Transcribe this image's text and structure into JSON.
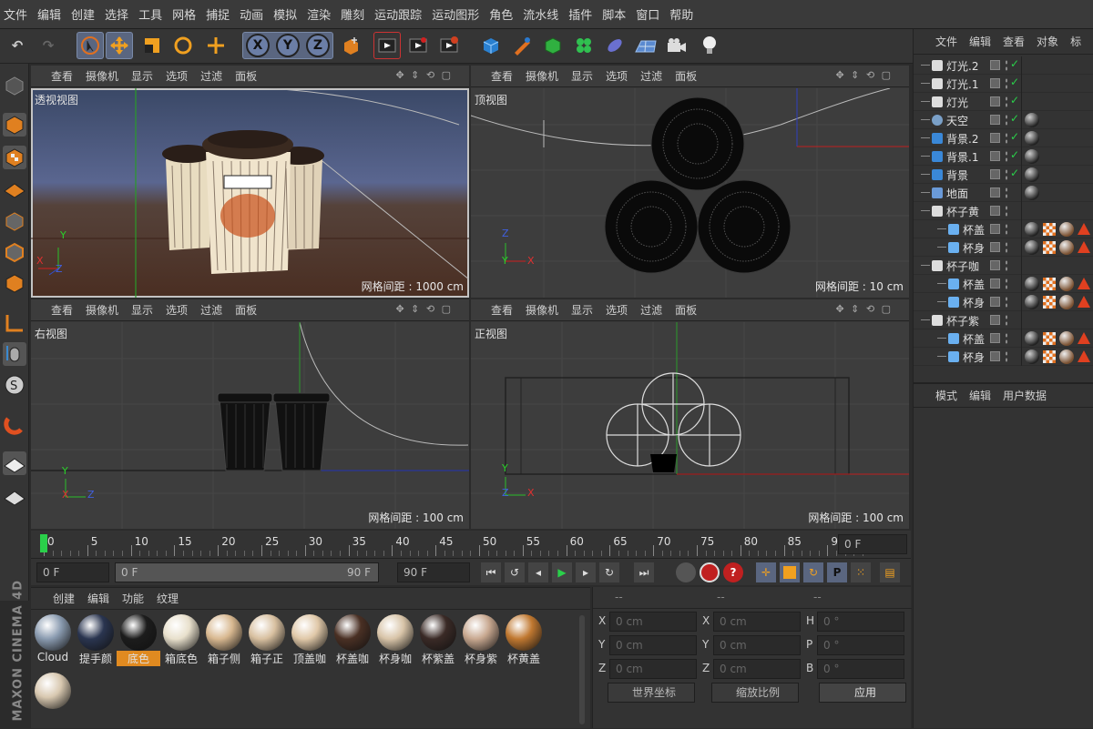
{
  "menu": [
    "文件",
    "编辑",
    "创建",
    "选择",
    "工具",
    "网格",
    "捕捉",
    "动画",
    "模拟",
    "渲染",
    "雕刻",
    "运动跟踪",
    "运动图形",
    "角色",
    "流水线",
    "插件",
    "脚本",
    "窗口",
    "帮助"
  ],
  "toolbar": {
    "axis_x": "X",
    "axis_y": "Y",
    "axis_z": "Z"
  },
  "viewport_menu": [
    "查看",
    "摄像机",
    "显示",
    "选项",
    "过滤",
    "面板"
  ],
  "viewports": [
    {
      "name": "透视视图",
      "grid": "网格间距 : 1000 cm"
    },
    {
      "name": "顶视图",
      "grid": "网格间距 : 10 cm"
    },
    {
      "name": "右视图",
      "grid": "网格间距 : 100 cm"
    },
    {
      "name": "正视图",
      "grid": "网格间距 : 100 cm"
    }
  ],
  "axis_labels": {
    "x": "X",
    "y": "Y",
    "z": "Z"
  },
  "timeline": {
    "ticks": [
      "0",
      "5",
      "10",
      "15",
      "20",
      "25",
      "30",
      "35",
      "40",
      "45",
      "50",
      "55",
      "60",
      "65",
      "70",
      "75",
      "80",
      "85",
      "90"
    ],
    "current_frame": "0 F",
    "start": "0 F",
    "range_start": "0 F",
    "range_end": "90 F",
    "end": "90 F"
  },
  "material_menu": [
    "创建",
    "编辑",
    "功能",
    "纹理"
  ],
  "materials": [
    {
      "label": "Cloud",
      "color": "#8a9bb0"
    },
    {
      "label": "提手颜",
      "color": "#2a3550"
    },
    {
      "label": "底色",
      "color": "#1c1c1c",
      "selected": true
    },
    {
      "label": "箱底色",
      "color": "#e8e0cc"
    },
    {
      "label": "箱子侧",
      "color": "#d8b890"
    },
    {
      "label": "箱子正",
      "color": "#d8c0a0"
    },
    {
      "label": "顶盖咖",
      "color": "#e0c8a8"
    },
    {
      "label": "杯盖咖",
      "color": "#4a3024"
    },
    {
      "label": "杯身咖",
      "color": "#d8c4a8"
    },
    {
      "label": "杯紫盖",
      "color": "#3a2a26"
    },
    {
      "label": "杯身紫",
      "color": "#c8a890"
    },
    {
      "label": "杯黄盖",
      "color": "#c07830"
    },
    {
      "label": "",
      "color": "#d8c8b0"
    }
  ],
  "coordinates": {
    "headers": [
      "--",
      "--",
      "--"
    ],
    "rows": [
      {
        "a": "X",
        "av": "0 cm",
        "b": "X",
        "bv": "0 cm",
        "c": "H",
        "cv": "0 °"
      },
      {
        "a": "Y",
        "av": "0 cm",
        "b": "Y",
        "bv": "0 cm",
        "c": "P",
        "cv": "0 °"
      },
      {
        "a": "Z",
        "av": "0 cm",
        "b": "Z",
        "bv": "0 cm",
        "c": "B",
        "cv": "0 °"
      }
    ],
    "world": "世界坐标",
    "scale": "缩放比例",
    "apply": "应用"
  },
  "object_menu": [
    "文件",
    "编辑",
    "查看",
    "对象",
    "标"
  ],
  "objects": [
    {
      "label": "灯光.2",
      "indent": 0,
      "icon": "light"
    },
    {
      "label": "灯光.1",
      "indent": 0,
      "icon": "light"
    },
    {
      "label": "灯光",
      "indent": 0,
      "icon": "light"
    },
    {
      "label": "天空",
      "indent": 0,
      "icon": "sky"
    },
    {
      "label": "背景.2",
      "indent": 0,
      "icon": "bg"
    },
    {
      "label": "背景.1",
      "indent": 0,
      "icon": "bg"
    },
    {
      "label": "背景",
      "indent": 0,
      "icon": "bg"
    },
    {
      "label": "地面",
      "indent": 0,
      "icon": "floor"
    },
    {
      "label": "杯子黄",
      "indent": 0,
      "icon": "null"
    },
    {
      "label": "杯盖",
      "indent": 1,
      "icon": "mesh"
    },
    {
      "label": "杯身",
      "indent": 1,
      "icon": "mesh"
    },
    {
      "label": "杯子咖",
      "indent": 0,
      "icon": "null"
    },
    {
      "label": "杯盖",
      "indent": 1,
      "icon": "mesh"
    },
    {
      "label": "杯身",
      "indent": 1,
      "icon": "mesh"
    },
    {
      "label": "杯子紫",
      "indent": 0,
      "icon": "null"
    },
    {
      "label": "杯盖",
      "indent": 1,
      "icon": "mesh"
    },
    {
      "label": "杯身",
      "indent": 1,
      "icon": "mesh"
    }
  ],
  "attr_menu": [
    "模式",
    "编辑",
    "用户数据"
  ],
  "brand": "MAXON CINEMA 4D"
}
